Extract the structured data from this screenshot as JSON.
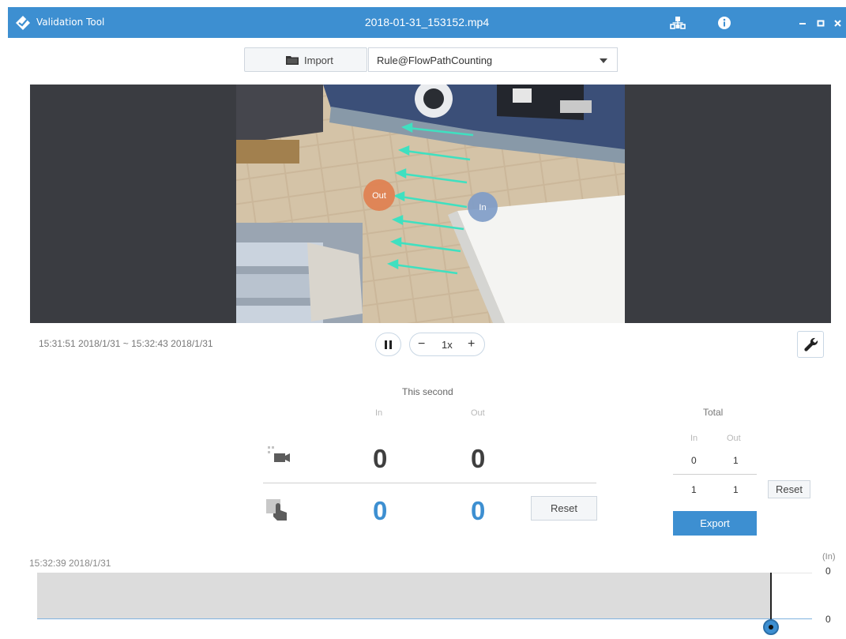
{
  "titlebar": {
    "app_name": "Validation Tool",
    "file_name": "2018-01-31_153152.mp4",
    "icons": [
      "logo-icon",
      "network-icon",
      "info-icon",
      "minimize-icon",
      "maximize-icon",
      "close-icon"
    ],
    "color": "#3d8fd1"
  },
  "toolbar": {
    "import_label": "Import",
    "rule_selected": "Rule@FlowPathCounting"
  },
  "video": {
    "out_label": "Out",
    "in_label": "In"
  },
  "playback": {
    "range": "15:31:51 2018/1/31 ~ 15:32:43 2018/1/31",
    "speed": "1x",
    "minus": "−",
    "plus": "+"
  },
  "counts": {
    "this_second_title": "This second",
    "in_header": "In",
    "out_header": "Out",
    "camera_row": {
      "in": "0",
      "out": "0"
    },
    "manual_row": {
      "in": "0",
      "out": "0"
    },
    "reset_label": "Reset"
  },
  "total": {
    "title": "Total",
    "in_header": "In",
    "out_header": "Out",
    "camera_row": {
      "in": "0",
      "out": "1"
    },
    "manual_row": {
      "in": "1",
      "out": "1"
    },
    "reset_label": "Reset",
    "export_label": "Export"
  },
  "timeline": {
    "time": "15:32:39 2018/1/31",
    "unit": "(In)",
    "top_value": "0",
    "bottom_value": "0"
  },
  "colors": {
    "accent": "#3d8fd1",
    "video_bg": "#3a3c41",
    "out_marker": "#e08050",
    "in_marker": "#7f9cc8"
  }
}
